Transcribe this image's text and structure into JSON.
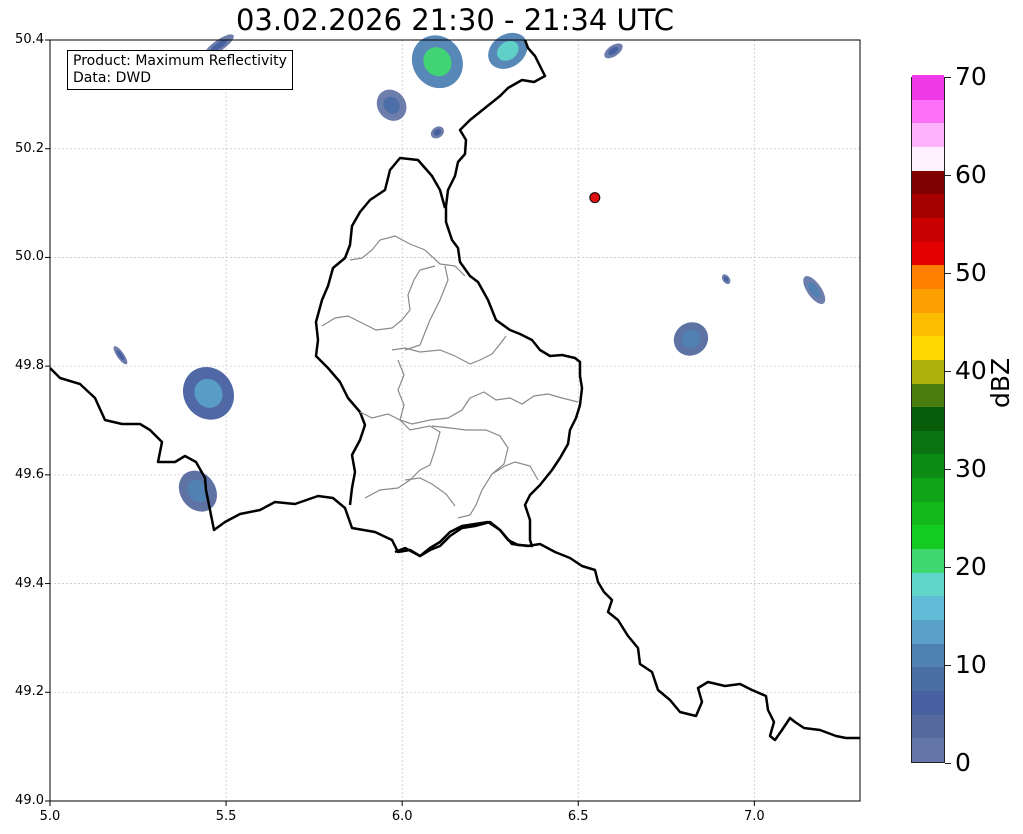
{
  "title": "03.02.2026 21:30 - 21:34 UTC",
  "info": {
    "product": "Product: Maximum Reflectivity",
    "data": "Data: DWD"
  },
  "axes": {
    "lon_range": [
      5.0,
      7.3
    ],
    "lat_range": [
      49.0,
      50.4
    ],
    "x_ticks": [
      "5.0",
      "5.5",
      "6.0",
      "6.5",
      "7.0"
    ],
    "y_ticks": [
      "50.4",
      "50.2",
      "50.0",
      "49.8",
      "49.6",
      "49.4",
      "49.2",
      "49.0"
    ],
    "grid": true
  },
  "marker": {
    "lon": 6.547,
    "lat": 50.11,
    "color": "#e01010"
  },
  "colorbar": {
    "label": "dBZ",
    "range": [
      0,
      70
    ],
    "ticks": [
      "0",
      "10",
      "20",
      "30",
      "40",
      "50",
      "60",
      "70"
    ],
    "colors": [
      "#6577a8",
      "#566a9f",
      "#4760a0",
      "#4a6fa5",
      "#4f82b3",
      "#5aa0c8",
      "#60bcd6",
      "#5fd4c8",
      "#3fd870",
      "#14cc20",
      "#12b81a",
      "#0fa318",
      "#0c8c12",
      "#0a7410",
      "#085d0b",
      "#4b7c0e",
      "#b0b00a",
      "#fdd700",
      "#fcbc00",
      "#fd9f00",
      "#fd7f00",
      "#e20000",
      "#c80000",
      "#a60000",
      "#7f0000",
      "#fff0fd",
      "#ffb3fc",
      "#ff71f8",
      "#f03ae8"
    ]
  },
  "echoes": [
    {
      "lon": 5.45,
      "lat": 49.75,
      "rx": 0.07,
      "ry": 0.05,
      "dbz": 14
    },
    {
      "lon": 5.42,
      "lat": 49.57,
      "rx": 0.05,
      "ry": 0.04,
      "dbz": 12
    },
    {
      "lon": 5.97,
      "lat": 50.28,
      "rx": 0.04,
      "ry": 0.03,
      "dbz": 8
    },
    {
      "lon": 6.1,
      "lat": 50.36,
      "rx": 0.07,
      "ry": 0.05,
      "dbz": 20
    },
    {
      "lon": 6.3,
      "lat": 50.38,
      "rx": 0.06,
      "ry": 0.03,
      "dbz": 18
    },
    {
      "lon": 5.48,
      "lat": 50.39,
      "rx": 0.05,
      "ry": 0.01,
      "dbz": 6
    },
    {
      "lon": 6.82,
      "lat": 49.85,
      "rx": 0.05,
      "ry": 0.03,
      "dbz": 12
    },
    {
      "lon": 7.17,
      "lat": 49.94,
      "rx": 0.02,
      "ry": 0.03,
      "dbz": 10
    },
    {
      "lon": 6.6,
      "lat": 50.38,
      "rx": 0.03,
      "ry": 0.01,
      "dbz": 6
    },
    {
      "lon": 6.1,
      "lat": 50.23,
      "rx": 0.02,
      "ry": 0.01,
      "dbz": 6
    },
    {
      "lon": 5.2,
      "lat": 49.82,
      "rx": 0.01,
      "ry": 0.02,
      "dbz": 6
    },
    {
      "lon": 6.92,
      "lat": 49.96,
      "rx": 0.01,
      "ry": 0.01,
      "dbz": 6
    }
  ]
}
